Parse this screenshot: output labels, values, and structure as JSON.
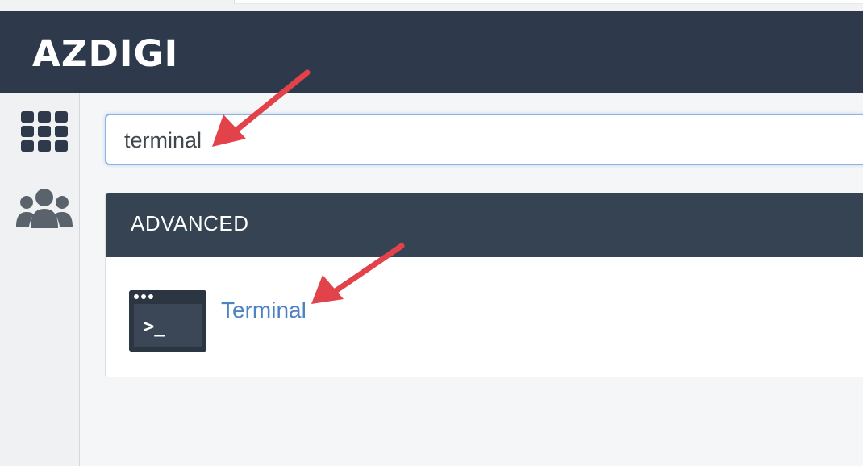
{
  "header": {
    "brand": "AZDIGI"
  },
  "sidebar": {
    "items": [
      {
        "icon": "apps-grid-icon"
      },
      {
        "icon": "users-icon"
      }
    ]
  },
  "search": {
    "value": "terminal",
    "placeholder": ""
  },
  "results": {
    "section_title": "ADVANCED",
    "items": [
      {
        "label": "Terminal",
        "icon": "terminal-icon",
        "icon_glyph": ">_"
      }
    ]
  },
  "colors": {
    "header": "#2e3a4b",
    "panel_header": "#364352",
    "link": "#4d82c3",
    "annotation": "#e2434b",
    "search_focus_border": "#8ab4e8"
  }
}
